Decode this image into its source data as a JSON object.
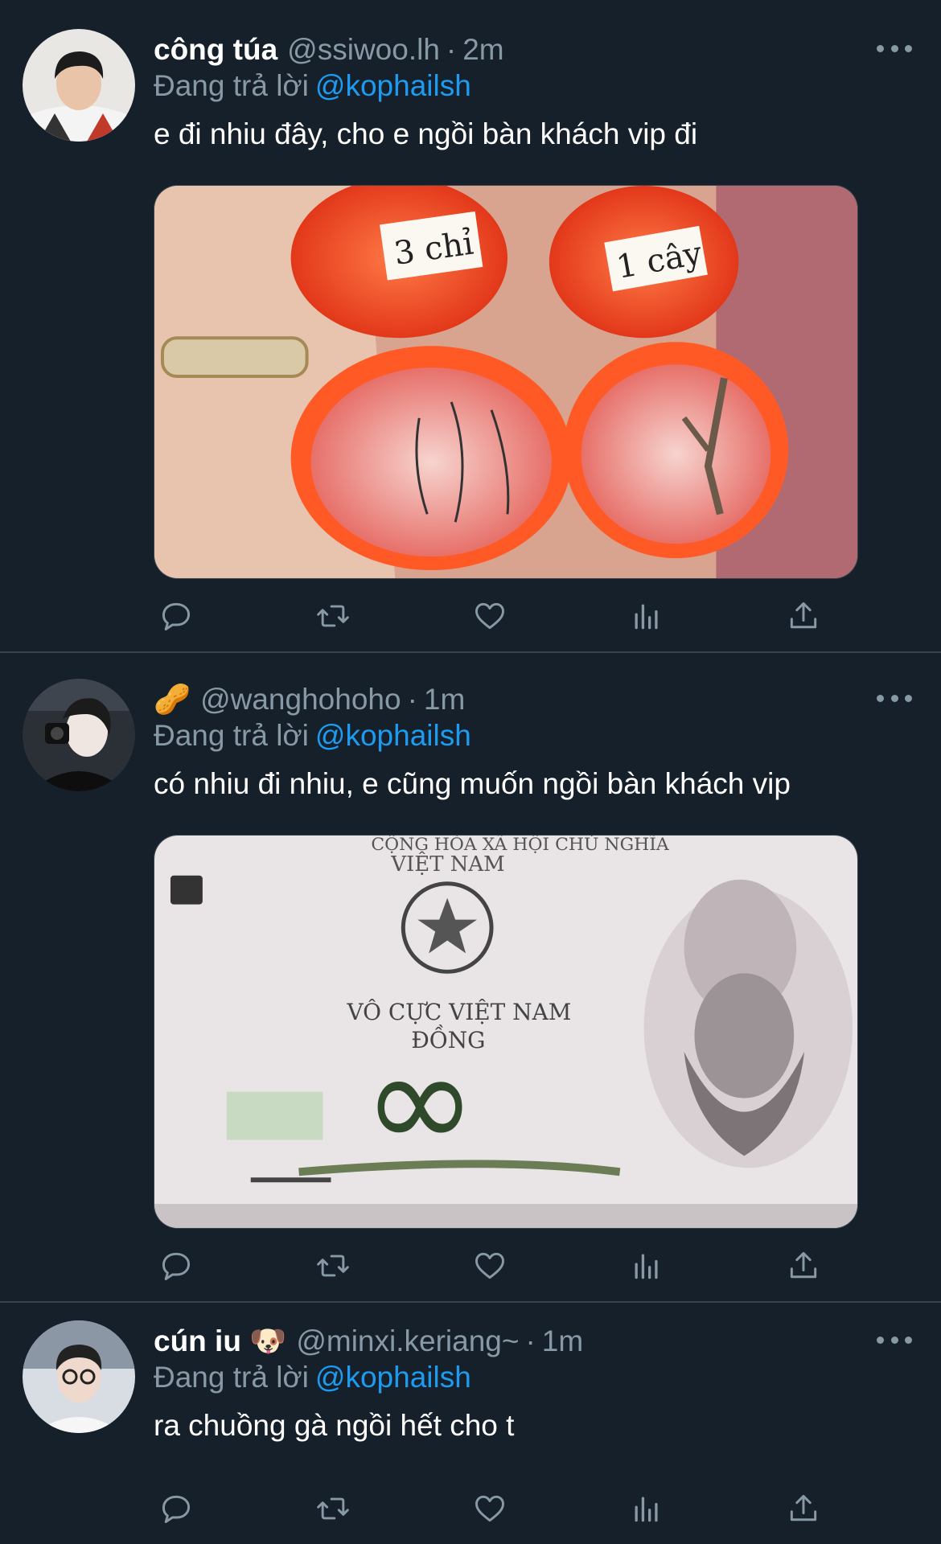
{
  "tweets": [
    {
      "name": "công túa",
      "handle": "@ssiwoo.lh",
      "dot": "·",
      "time": "2m",
      "reply_prefix": "Đang trả lời",
      "reply_to": "@kophailsh",
      "text": "e đi nhiu đây, cho e ngồi bàn khách vip đi",
      "media": {
        "label_a": "3 chỉ",
        "label_b": "1 cây"
      }
    },
    {
      "name": "",
      "name_emoji": "🥜",
      "handle": "@wanghohoho",
      "dot": "·",
      "time": "1m",
      "reply_prefix": "Đang trả lời",
      "reply_to": "@kophailsh",
      "text": "có nhiu đi nhiu, e cũng muốn ngồi bàn khách vip",
      "media": {
        "top_a": "CỘNG HÒA XÃ HỘI CHỦ NGHĨA",
        "top_b": "VIỆT NAM",
        "mid_a": "VÔ CỰC VIỆT NAM",
        "mid_b": "ĐỒNG",
        "symbol": "∞"
      }
    },
    {
      "name": "cún iu",
      "name_emoji": "🐶",
      "handle": "@minxi.keriang~",
      "dot": "·",
      "time": "1m",
      "reply_prefix": "Đang trả lời",
      "reply_to": "@kophailsh",
      "text": "ra chuồng gà ngồi hết cho t"
    }
  ],
  "icons": [
    "reply-icon",
    "retweet-icon",
    "like-icon",
    "analytics-icon",
    "share-icon"
  ],
  "colors": {
    "background": "#15202b",
    "secondary_text": "#8899a6",
    "link": "#1d9bf0",
    "divider": "#38444d"
  }
}
